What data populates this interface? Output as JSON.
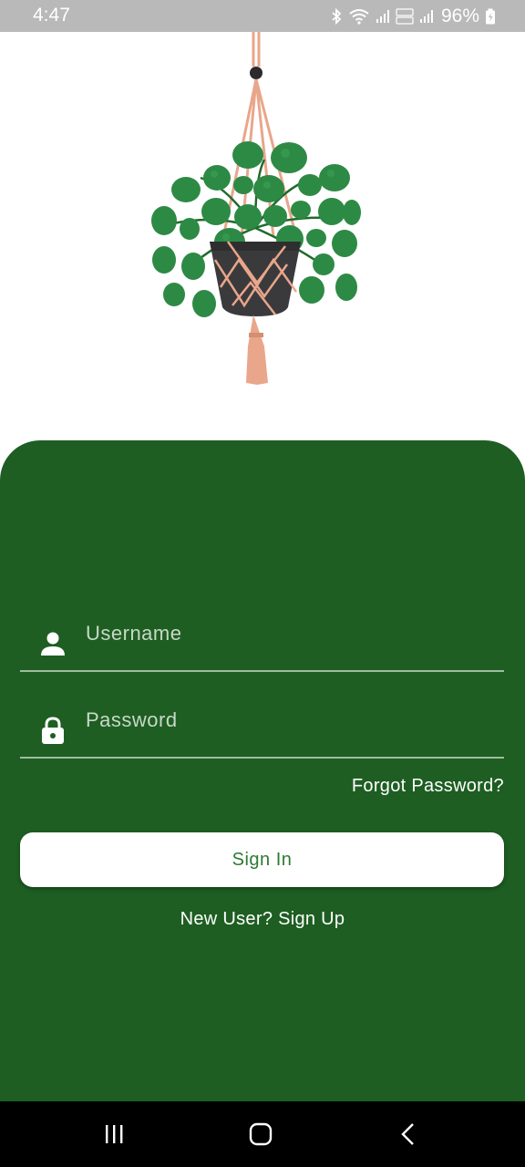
{
  "status_bar": {
    "time": "4:47",
    "battery_percent": "96%",
    "icons": [
      "bluetooth-icon",
      "wifi-icon",
      "signal-icon",
      "volte-icon",
      "signal-icon",
      "battery-charging-icon"
    ]
  },
  "illustration": {
    "icon": "hanging-plant-illustration"
  },
  "login": {
    "username_placeholder": "Username",
    "password_placeholder": "Password",
    "forgot_password": "Forgot Password?",
    "sign_in": "Sign In",
    "sign_up": "New User? Sign Up"
  },
  "colors": {
    "panel": "#1e5e22",
    "button_text": "#2d7a31",
    "status_bar": "#b9b9b9"
  },
  "nav_bar": {
    "icons": [
      "recent-apps-icon",
      "home-icon",
      "back-icon"
    ]
  }
}
